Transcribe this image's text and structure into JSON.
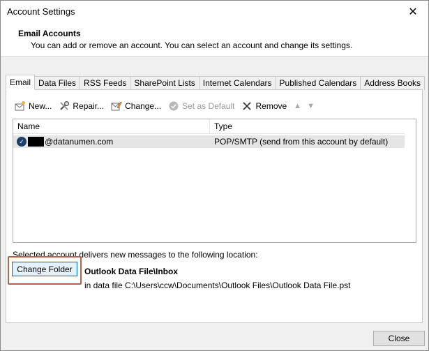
{
  "window": {
    "title": "Account Settings",
    "close_glyph": "✕"
  },
  "header": {
    "title": "Email Accounts",
    "subtitle": "You can add or remove an account. You can select an account and change its settings."
  },
  "tabs": [
    {
      "label": "Email",
      "active": true
    },
    {
      "label": "Data Files"
    },
    {
      "label": "RSS Feeds"
    },
    {
      "label": "SharePoint Lists"
    },
    {
      "label": "Internet Calendars"
    },
    {
      "label": "Published Calendars"
    },
    {
      "label": "Address Books"
    }
  ],
  "toolbar": {
    "new_label": "New...",
    "repair_label": "Repair...",
    "change_label": "Change...",
    "default_label": "Set as Default",
    "remove_label": "Remove"
  },
  "accounts": {
    "col_name": "Name",
    "col_type": "Type",
    "rows": [
      {
        "name": "@datanumen.com",
        "type": "POP/SMTP (send from this account by default)"
      }
    ]
  },
  "delivery": {
    "label": "Selected account delivers new messages to the following location:",
    "button": "Change Folder",
    "folder": "Outlook Data File\\Inbox",
    "path": "in data file C:\\Users\\ccw\\Documents\\Outlook Files\\Outlook Data File.pst"
  },
  "footer": {
    "close_label": "Close"
  },
  "colors": {
    "highlight": "#b0664a",
    "selection": "#e5e5e5",
    "accent": "#0078d7"
  }
}
